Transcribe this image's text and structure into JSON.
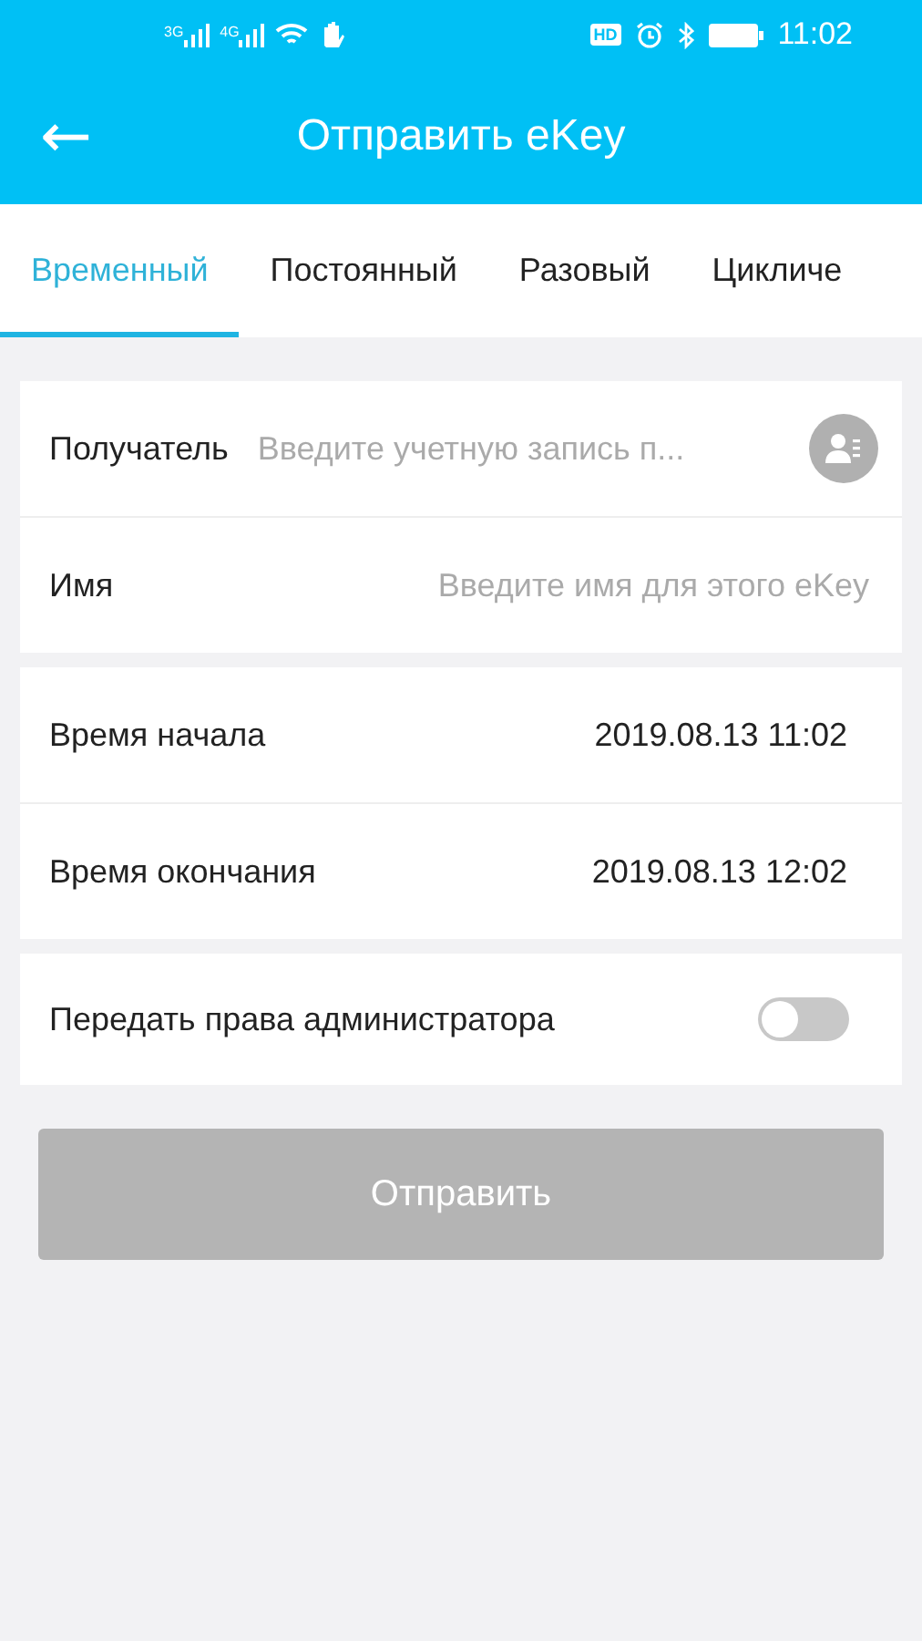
{
  "status_bar": {
    "network_labels": [
      "3G",
      "4G"
    ],
    "hd_label": "HD",
    "time": "11:02"
  },
  "header": {
    "back_icon": "←",
    "title": "Отправить eKey"
  },
  "tabs": [
    {
      "label": "Временный",
      "selected": true
    },
    {
      "label": "Постоянный",
      "selected": false
    },
    {
      "label": "Разовый",
      "selected": false
    },
    {
      "label": "Цикличе",
      "selected": false
    }
  ],
  "groups": [
    {
      "rows": [
        {
          "kind": "input",
          "label": "Получатель",
          "placeholder": "Введите учетную запись п...",
          "contact_button": true
        },
        {
          "kind": "input",
          "label": "Имя",
          "placeholder": "Введите имя для этого eKey",
          "contact_button": false
        }
      ]
    },
    {
      "rows": [
        {
          "kind": "value",
          "label": "Время начала",
          "value": "2019.08.13 11:02"
        },
        {
          "kind": "value",
          "label": "Время окончания",
          "value": "2019.08.13 12:02"
        }
      ]
    },
    {
      "rows": [
        {
          "kind": "toggle",
          "label": "Передать права администратора",
          "on": false
        }
      ]
    }
  ],
  "submit": {
    "label": "Отправить",
    "disabled": true
  }
}
